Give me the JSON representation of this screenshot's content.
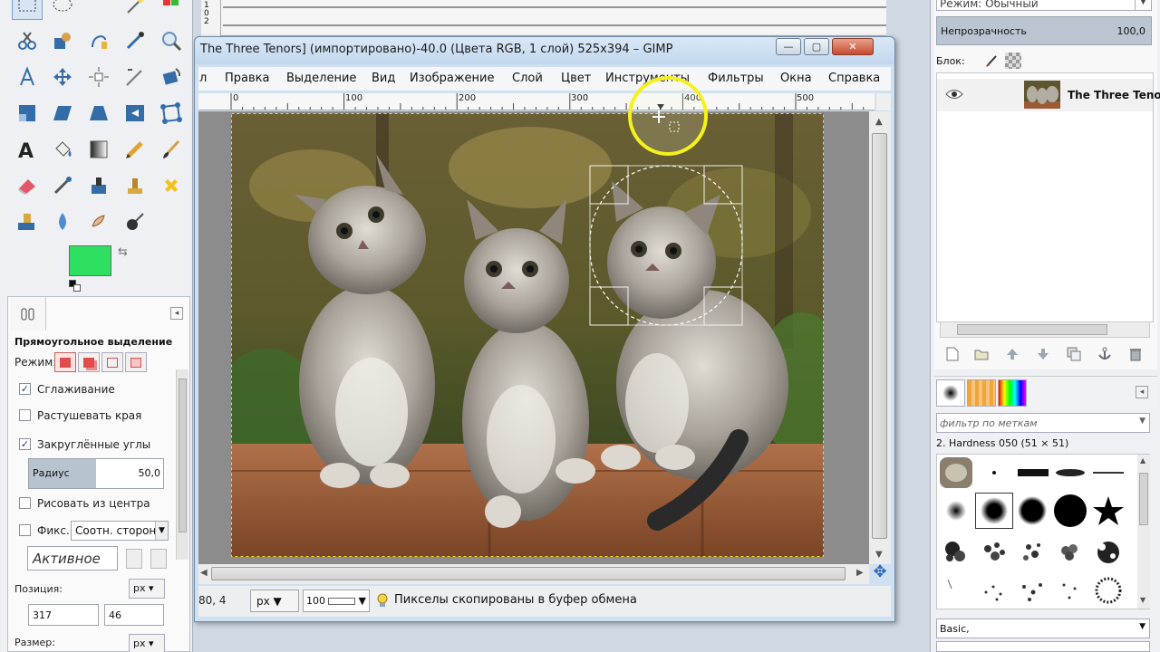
{
  "toolbox": {
    "tool_options_title": "Прямоугольное выделение",
    "mode_label": "Режим:",
    "antialias_label": "Сглаживание",
    "antialias_checked": true,
    "feather_label": "Растушевать края",
    "feather_checked": false,
    "rounded_label": "Закруглённые углы",
    "rounded_checked": true,
    "radius_label": "Радиус",
    "radius_value": "50,0",
    "radius_fraction": 0.5,
    "from_center_label": "Рисовать из центра",
    "from_center_checked": false,
    "fixed_label": "Фикс.:",
    "fixed_checked": false,
    "fixed_value": "Соотн. сторон",
    "aspect_entry": "Активное",
    "position_label": "Позиция:",
    "position_unit": "px",
    "position_x": "317",
    "position_y": "46",
    "size_label": "Размер:",
    "size_unit": "px",
    "fg_color": "#2ee05f",
    "bg_color": "#ffffff"
  },
  "back_ruler": {
    "vert_digits": "1\n0\n2"
  },
  "window": {
    "title": "The Three Tenors] (импортировано)-40.0 (Цвета RGB, 1 слой) 525x394 – GIMP",
    "min_label": "—",
    "max_label": "▢",
    "close_label": "✕"
  },
  "menu": [
    "л",
    "Правка",
    "Выделение",
    "Вид",
    "Изображение",
    "Слой",
    "Цвет",
    "Инструменты",
    "Фильтры",
    "Окна",
    "Справка"
  ],
  "ruler": {
    "ticks": [
      "0",
      "100",
      "200",
      "300",
      "400",
      "500"
    ]
  },
  "status": {
    "coords": "80, 4",
    "unit": "px",
    "zoom": "100",
    "message": "Пикселы скопированы в буфер обмена"
  },
  "dock": {
    "mode_label": "Режим: Обычный",
    "opacity_label": "Непрозрачность",
    "opacity_value": "100,0",
    "opacity_fraction": 1.0,
    "lock_label": "Блок:",
    "layer_name": "The Three Tenors",
    "brush_filter_placeholder": "фильтр по меткам",
    "brush_name": "2. Hardness 050 (51 × 51)",
    "preset": "Basic,"
  },
  "colors": {
    "accent_blue": "#2a66b5",
    "highlight_yellow": "#f4f11b"
  }
}
